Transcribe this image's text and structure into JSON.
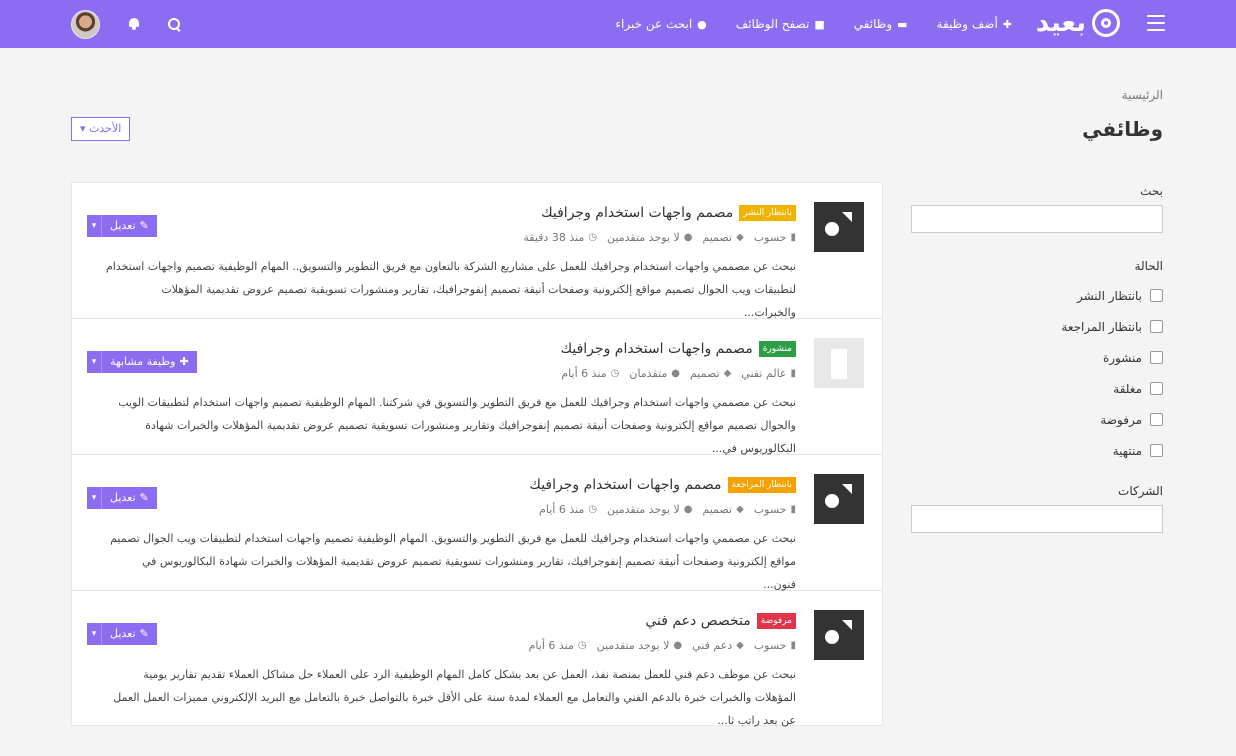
{
  "nav": {
    "logo_text": "بعيد",
    "links": [
      {
        "label": "أضف وظيفة",
        "icon": "plus-icon",
        "glyph": "✚"
      },
      {
        "label": "وظائفي",
        "icon": "folder-icon",
        "glyph": "▬"
      },
      {
        "label": "تصفح الوظائف",
        "icon": "briefcase-icon",
        "glyph": "■"
      },
      {
        "label": "ابحث عن خبراء",
        "icon": "users-icon",
        "glyph": "●"
      }
    ]
  },
  "breadcrumb": "الرئيسية",
  "page_title": "وظائفي",
  "sort_label": "الأحدث",
  "filters": {
    "search_label": "بحث",
    "status_label": "الحالة",
    "statuses": [
      "بانتظار النشر",
      "بانتظار المراجعة",
      "منشورة",
      "مغلقة",
      "مرفوضة",
      "منتهية"
    ],
    "companies_label": "الشركات"
  },
  "colors": {
    "accent": "#8c6cf0",
    "pending_publish": "#f0b400",
    "published": "#2e9e44",
    "pending_review": "#f5a100",
    "rejected": "#e0344a"
  },
  "jobs": [
    {
      "badge": "بانتظار النشر",
      "title": "مصمم واجهات استخدام وجرافيك",
      "company": "حسوب",
      "category": "تصميم",
      "experience": "لا يوجد متقدمين",
      "time": "منذ 38 دقيقة",
      "desc": "نبحث عن مصممي واجهات استخدام وجرافيك للعمل على مشاريع الشركة بالتعاون مع فريق التطوير والتسويق.. المهام الوظيفية تصميم واجهات استخدام لتطبيقات ويب الجوال تصميم مواقع إلكترونية وصفحات أنيقة تصميم إنفوجرافيك، تقارير ومنشورات تسويقية تصميم عروض تقديمية المؤهلات والخبرات...",
      "action": "تعديل"
    },
    {
      "badge": "منشورة",
      "title": "مصمم واجهات استخدام وجرافيك",
      "company": "عالم تقني",
      "category": "تصميم",
      "experience": "متقدمان",
      "time": "منذ 6 أيام",
      "desc": "نبحث عن مصممي واجهات استخدام وجرافيك للعمل مع فريق التطوير والتسويق في شركتنا. المهام الوظيفية تصميم واجهات استخدام لتطبيقات الويب والجوال تصميم مواقع إلكترونية وصفحات أنيقة تصميم إنفوجرافيك وتقارير ومنشورات تسويقية تصميم عروض تقديمية المؤهلات والخبرات شهادة البكالوريوس في...",
      "action": "وظيفة مشابهة"
    },
    {
      "badge": "بانتظار المراجعة",
      "title": "مصمم واجهات استخدام وجرافيك",
      "company": "حسوب",
      "category": "تصميم",
      "experience": "لا يوجد متقدمين",
      "time": "منذ 6 أيام",
      "desc": "نبحث عن مصممي واجهات استخدام وجرافيك للعمل مع فريق التطوير والتسويق. المهام الوظيفية تصميم واجهات استخدام لتطبيقات ويب الجوال تصميم مواقع إلكترونية وصفحات أنيقة تصميم إنفوجرافيك، تقارير ومنشورات تسويقية تصميم عروض تقديمية المؤهلات والخبرات شهادة البكالوريوس في فنون...",
      "action": "تعديل"
    },
    {
      "badge": "مرفوضة",
      "title": "متخصص دعم فني",
      "company": "حسوب",
      "category": "دعم فني",
      "experience": "لا يوجد متقدمين",
      "time": "منذ 6 أيام",
      "desc": "نبحث عن موظف دعم فني للعمل بمنصة نفذ، العمل عن بعد بشكل كامل المهام الوظيفية الرد على العملاء حل مشاكل العملاء تقديم تقارير يومية المؤهلات والخبرات خبرة بالدعم الفني والتعامل مع العملاء لمدة سنة على الأقل خبرة بالتواصل خبرة بالتعامل مع البريد الإلكتروني مميزات العمل العمل عن بعد راتب ثا...",
      "action": "تعديل"
    }
  ]
}
